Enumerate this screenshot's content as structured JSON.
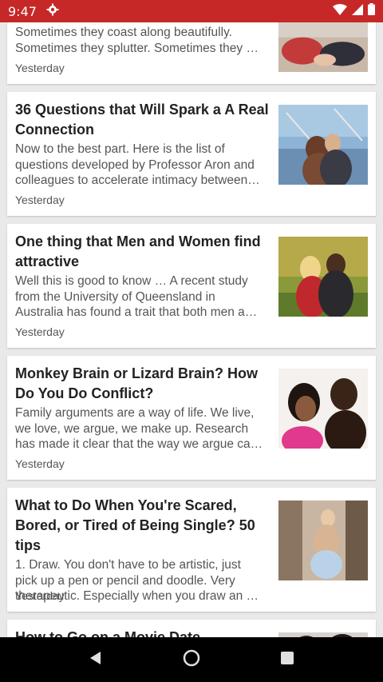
{
  "status_bar": {
    "time": "9:47",
    "icons": [
      "settings-icon",
      "wifi-icon",
      "signal-icon",
      "battery-icon"
    ],
    "background": "#c62828"
  },
  "articles": [
    {
      "title": "",
      "snippet_lines": [
        "Sometimes they coast along beautifully.",
        "Sometimes they splutter. Sometimes they …"
      ],
      "date": "Yesterday"
    },
    {
      "title": "36 Questions that Will Spark a A Real Connection",
      "snippet_lines": [
        "Now to the best part. Here is the list of",
        "questions developed by Professor Aron and",
        "colleagues to accelerate intimacy between…"
      ],
      "date": "Yesterday"
    },
    {
      "title": "One thing that Men and Women find attractive",
      "snippet_lines": [
        "Well this is good to know … A recent study",
        "from the University of Queensland in",
        "Australia has found a trait that both men a…"
      ],
      "date": "Yesterday"
    },
    {
      "title": "Monkey Brain or Lizard Brain? How Do You Do Conflict?",
      "snippet_lines": [
        "Family arguments are a way of life. We live,",
        "we love, we argue, we make up. Research",
        "has made it clear that the way we argue ca…"
      ],
      "date": "Yesterday"
    },
    {
      "title": "What to Do When You're Scared, Bored, or Tired of Being Single? 50 tips",
      "snippet_lines": [
        "1. Draw. You don't have to be artistic, just",
        "pick up a pen or pencil and doodle. Very",
        "therapeutic. Especially when you draw an …"
      ],
      "date": "Yesterday"
    },
    {
      "title": "How to Go on a Movie Date",
      "snippet_lines": [],
      "date": ""
    }
  ],
  "nav_bar": {
    "icons": [
      "back-icon",
      "home-icon",
      "recents-icon"
    ]
  }
}
